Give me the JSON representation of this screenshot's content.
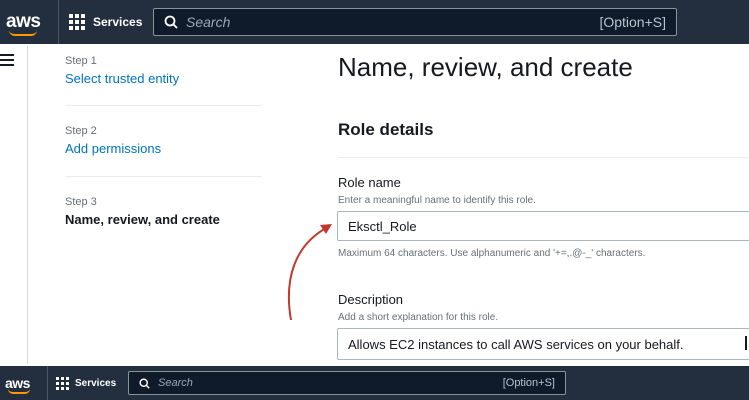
{
  "navbar": {
    "logo": "aws",
    "services_label": "Services",
    "search_placeholder": "Search",
    "search_shortcut": "[Option+S]"
  },
  "wizard": {
    "steps": [
      {
        "number": "Step 1",
        "label": "Select trusted entity",
        "state": "link"
      },
      {
        "number": "Step 2",
        "label": "Add permissions",
        "state": "link"
      },
      {
        "number": "Step 3",
        "label": "Name, review, and create",
        "state": "current"
      }
    ]
  },
  "main": {
    "title": "Name, review, and create",
    "section_title": "Role details",
    "role_name": {
      "label": "Role name",
      "description": "Enter a meaningful name to identify this role.",
      "value": "Eksctl_Role",
      "constraint": "Maximum 64 characters. Use alphanumeric and '+=,.@-_' characters."
    },
    "description": {
      "label": "Description",
      "description": "Add a short explanation for this role.",
      "value": "Allows EC2 instances to call AWS services on your behalf."
    }
  },
  "colors": {
    "navbar_bg": "#232f3e",
    "link": "#0073bb",
    "annotation_arrow": "#c0392b",
    "aws_smile": "#ff9900"
  }
}
